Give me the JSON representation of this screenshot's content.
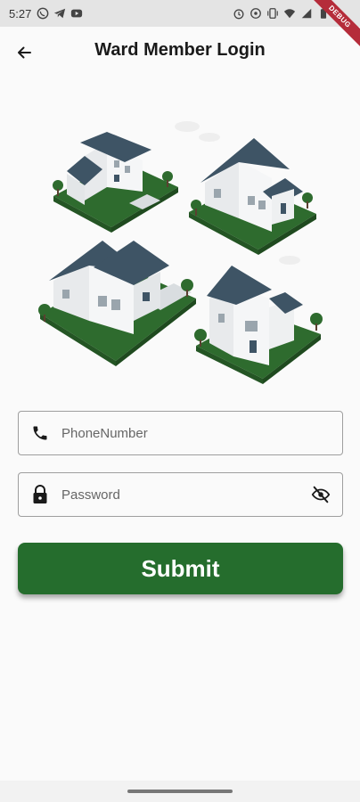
{
  "status_bar": {
    "time": "5:27",
    "debug_label": "DEBUG"
  },
  "app_bar": {
    "title": "Ward Member Login",
    "back_icon": "arrow-left-icon"
  },
  "form": {
    "phone": {
      "placeholder": "PhoneNumber",
      "value": "",
      "icon": "phone-icon"
    },
    "password": {
      "placeholder": "Password",
      "value": "",
      "icon": "lock-icon",
      "toggle_icon": "eye-off-icon"
    },
    "submit_label": "Submit"
  },
  "colors": {
    "primary": "#256d2d",
    "roof": "#3e5465",
    "grass": "#2e6b2e"
  }
}
